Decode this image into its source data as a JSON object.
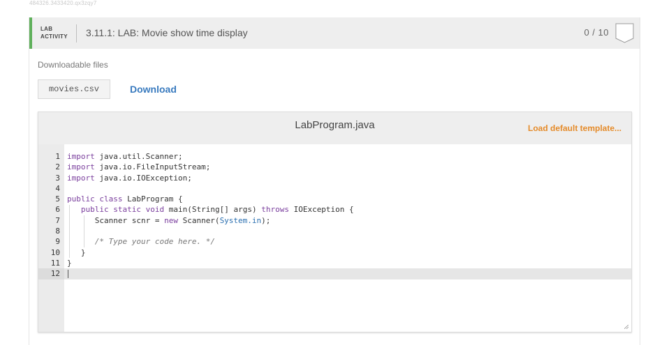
{
  "page": {
    "id_text": "484326.3433420.qx3zqy7"
  },
  "header": {
    "tag_line1": "LAB",
    "tag_line2": "ACTIVITY",
    "title": "3.11.1: LAB: Movie show time display",
    "score": "0 / 10"
  },
  "downloads": {
    "label": "Downloadable files",
    "file_name": "movies.csv",
    "download_label": "Download"
  },
  "editor": {
    "file_name": "LabProgram.java",
    "load_label": "Load default template...",
    "lines": [
      {
        "n": "1",
        "code": "import java.util.Scanner;"
      },
      {
        "n": "2",
        "code": "import java.io.FileInputStream;"
      },
      {
        "n": "3",
        "code": "import java.io.IOException;"
      },
      {
        "n": "4",
        "code": ""
      },
      {
        "n": "5",
        "code": "public class LabProgram {"
      },
      {
        "n": "6",
        "code": "   public static void main(String[] args) throws IOException {"
      },
      {
        "n": "7",
        "code": "      Scanner scnr = new Scanner(System.in);"
      },
      {
        "n": "8",
        "code": ""
      },
      {
        "n": "9",
        "code": "      /* Type your code here. */"
      },
      {
        "n": "10",
        "code": "   }"
      },
      {
        "n": "11",
        "code": "}"
      },
      {
        "n": "12",
        "code": ""
      }
    ]
  },
  "colors": {
    "accent_green": "#5fb05b",
    "link_blue": "#3a7bbf",
    "orange": "#e58b2a"
  },
  "icons": {
    "badge": "score-badge-icon",
    "resize": "resize-grip-icon"
  }
}
